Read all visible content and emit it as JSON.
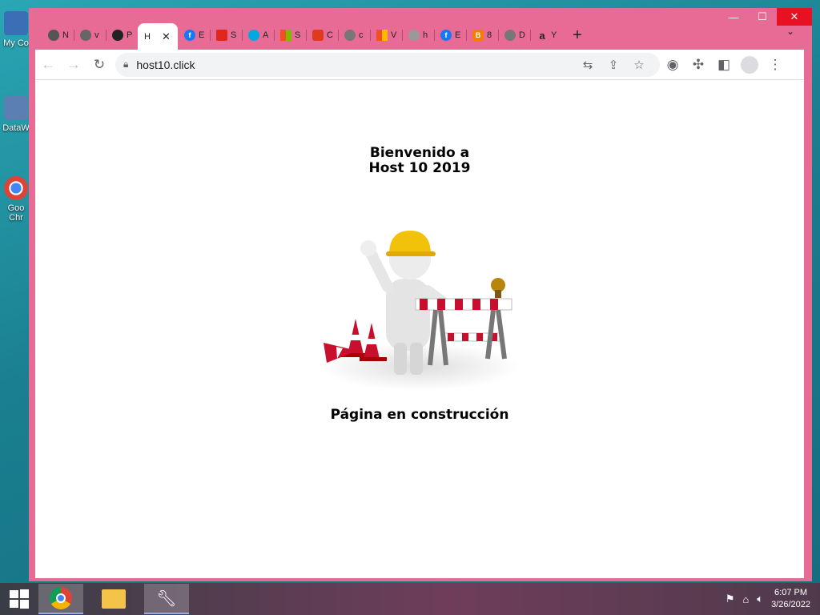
{
  "desktop": {
    "icons": [
      {
        "label": "My Co"
      },
      {
        "label": "DataW"
      },
      {
        "label": "Goo Chr"
      }
    ]
  },
  "window": {
    "minimize": "—",
    "maximize": "☐",
    "close": "✕",
    "tab_search": "⌄"
  },
  "tabs": [
    {
      "text": "N",
      "favicon_color": "#555555"
    },
    {
      "text": "v",
      "favicon_color": "#666666"
    },
    {
      "text": "P",
      "favicon_color": "#222222"
    },
    {
      "text": "H",
      "favicon_color": "#ffffff",
      "active": true
    },
    {
      "text": "E",
      "favicon_color": "#1877f2"
    },
    {
      "text": "S",
      "favicon_color": "#e1261c"
    },
    {
      "text": "A",
      "favicon_color": "#00a8e0"
    },
    {
      "text": "S",
      "favicon_color": "#f25022"
    },
    {
      "text": "C",
      "favicon_color": "#e03a1e"
    },
    {
      "text": "c",
      "favicon_color": "#777777"
    },
    {
      "text": "V",
      "favicon_color": "#f25022"
    },
    {
      "text": "h",
      "favicon_color": "#999999"
    },
    {
      "text": "E",
      "favicon_color": "#1877f2"
    },
    {
      "text": "8",
      "favicon_color": "#f57d00"
    },
    {
      "text": "D",
      "favicon_color": "#777777"
    },
    {
      "text": "Y",
      "favicon_color": "#222222"
    }
  ],
  "toolbar": {
    "url": "host10.click"
  },
  "page": {
    "welcome_line1": "Bienvenido a",
    "welcome_line2": "Host 10 2019",
    "footer": "Página en construcción"
  },
  "taskbar": {
    "time": "6:07 PM",
    "date": "3/26/2022"
  }
}
